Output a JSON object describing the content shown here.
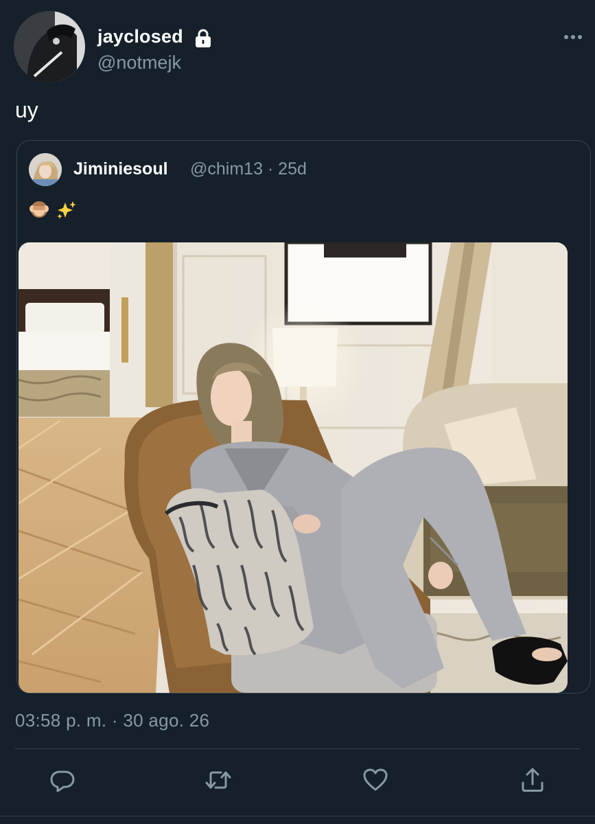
{
  "user": {
    "display_name": "jayclosed",
    "handle": "@notmejk",
    "protected_icon": "lock-icon"
  },
  "tweet": {
    "text": "uy",
    "timestamp": "03:58 p. m. · 30 ago. 26"
  },
  "quoted_tweet": {
    "display_name": "Jiminiesoul",
    "meta": "@chim13 · 25d",
    "text": "🙈✨"
  },
  "actions": [
    {
      "name": "reply",
      "icon": "reply-icon"
    },
    {
      "name": "retweet",
      "icon": "retweet-icon"
    },
    {
      "name": "like",
      "icon": "heart-icon"
    },
    {
      "name": "share",
      "icon": "share-icon"
    }
  ],
  "colors": {
    "background": "#15202b",
    "text_primary": "#ffffff",
    "text_secondary": "#8899a6",
    "border": "#38444d"
  }
}
